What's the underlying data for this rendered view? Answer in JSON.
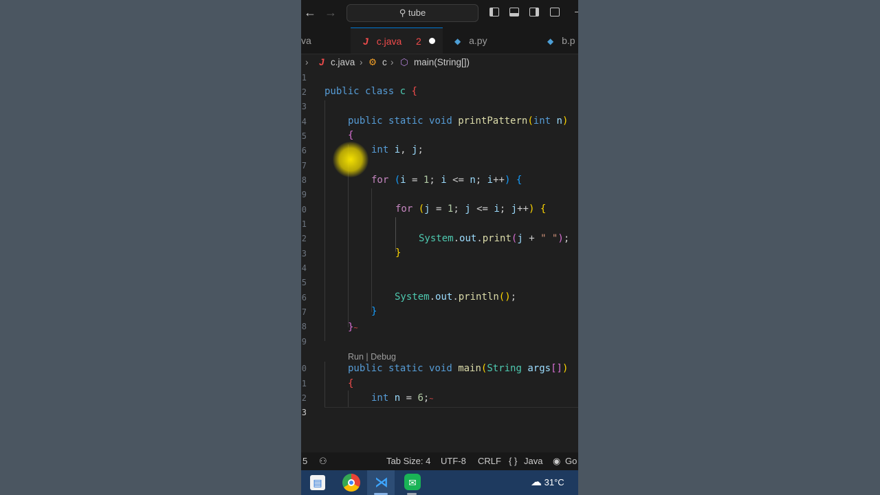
{
  "titlebar": {
    "search_text": "tube"
  },
  "tabs": [
    {
      "label": "va"
    },
    {
      "label": "c.java",
      "badge": "2"
    },
    {
      "label": "a.py"
    },
    {
      "label": "b.p"
    }
  ],
  "breadcrumb": {
    "file": "c.java",
    "class": "c",
    "method": "main(String[])"
  },
  "line_numbers": [
    "1",
    "2",
    "3",
    "4",
    "5",
    "6",
    "7",
    "8",
    "9",
    "0",
    "1",
    "2",
    "3",
    "4",
    "5",
    "6",
    "7",
    "8",
    "9",
    "0",
    "1",
    "2",
    "3"
  ],
  "codelens": "Run | Debug",
  "statusbar": {
    "left_num": "5",
    "tab_size": "Tab Size: 4",
    "encoding": "UTF-8",
    "eol": "CRLF",
    "language": "Java",
    "lang_icon": "{ }",
    "go_live": "Go"
  },
  "taskbar": {
    "temperature": "31°C"
  },
  "colors": {
    "accent": "#0078d4",
    "editor_bg": "#1f1f1f",
    "error": "#f14c4c"
  }
}
